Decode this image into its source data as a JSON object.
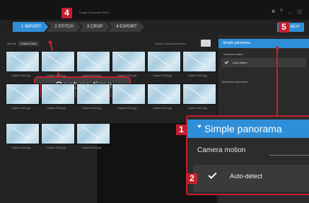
{
  "app": {
    "title": "Image Composite Editor",
    "window_controls": [
      "⚙",
      "?",
      "_",
      "▢"
    ]
  },
  "wizard": {
    "steps": [
      {
        "label": "1 IMPORT",
        "active": true
      },
      {
        "label": "2 STITCH",
        "active": false
      },
      {
        "label": "3 CROP",
        "active": false
      },
      {
        "label": "4 EXPORT",
        "active": false
      }
    ],
    "next_label": "NEXT"
  },
  "toolbar": {
    "sort_label": "Sort by",
    "sort_value": "Capture time",
    "drag_hint": "Drag & drop photos here"
  },
  "thumbnails": [
    {
      "label": "Capture 0001.jpg"
    },
    {
      "label": "Capture 0002.jpg"
    },
    {
      "label": "Capture 0003.jpg"
    },
    {
      "label": "Capture 0004.jpg"
    },
    {
      "label": "Capture 0005.jpg"
    },
    {
      "label": "Capture 0006.jpg"
    },
    {
      "label": "Capture 0007.jpg"
    },
    {
      "label": "Capture 0008.jpg"
    },
    {
      "label": "Capture 0009.jpg"
    },
    {
      "label": "Capture 0010.jpg"
    },
    {
      "label": "Capture 0011.jpg"
    },
    {
      "label": "Capture 0012.jpg"
    },
    {
      "label": "Capture 0013.jpg"
    },
    {
      "label": "Capture 0014.jpg"
    },
    {
      "label": "Capture 0015.jpg"
    }
  ],
  "right_panel": {
    "header": "Simple panorama",
    "camera_motion_label": "Camera motion",
    "camera_motion_value": "Auto-detect",
    "structured_label": "Structured panorama"
  },
  "callouts": {
    "capture_time": "Capture time",
    "zoom_header": "Simple panorama",
    "zoom_camera_motion": "Camera motion",
    "zoom_auto_detect": "Auto-detect"
  },
  "badges": [
    "1",
    "2",
    "3",
    "4",
    "5"
  ],
  "colors": {
    "accent": "#2e8fd8",
    "badge": "#c4202f",
    "background": "#222222"
  }
}
